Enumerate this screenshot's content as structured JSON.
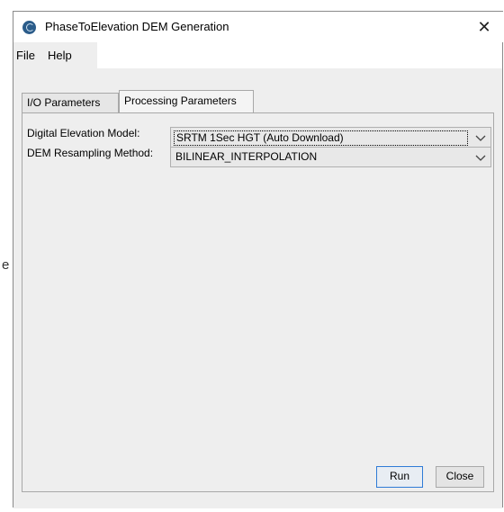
{
  "window": {
    "title": "PhaseToElevation DEM Generation",
    "close_glyph": "✕"
  },
  "menu": {
    "items": [
      {
        "label": "File"
      },
      {
        "label": "Help"
      }
    ]
  },
  "tabs": [
    {
      "label": "I/O Parameters",
      "active": false
    },
    {
      "label": "Processing Parameters",
      "active": true
    }
  ],
  "processing": {
    "dem_label": "Digital Elevation Model:",
    "dem_value": "SRTM 1Sec HGT (Auto Download)",
    "resampling_label": "DEM Resampling Method:",
    "resampling_value": "BILINEAR_INTERPOLATION"
  },
  "buttons": {
    "run": "Run",
    "close": "Close"
  },
  "colors": {
    "dialog_bg": "#eeeeee",
    "button_focus_border": "#2f7bd6",
    "app_icon": "#2b5c8a"
  },
  "icons": {
    "app": "app-logo-icon",
    "window_close": "close-icon",
    "dropdown": "chevron-down-icon"
  },
  "background": {
    "left_glyph": "e"
  }
}
